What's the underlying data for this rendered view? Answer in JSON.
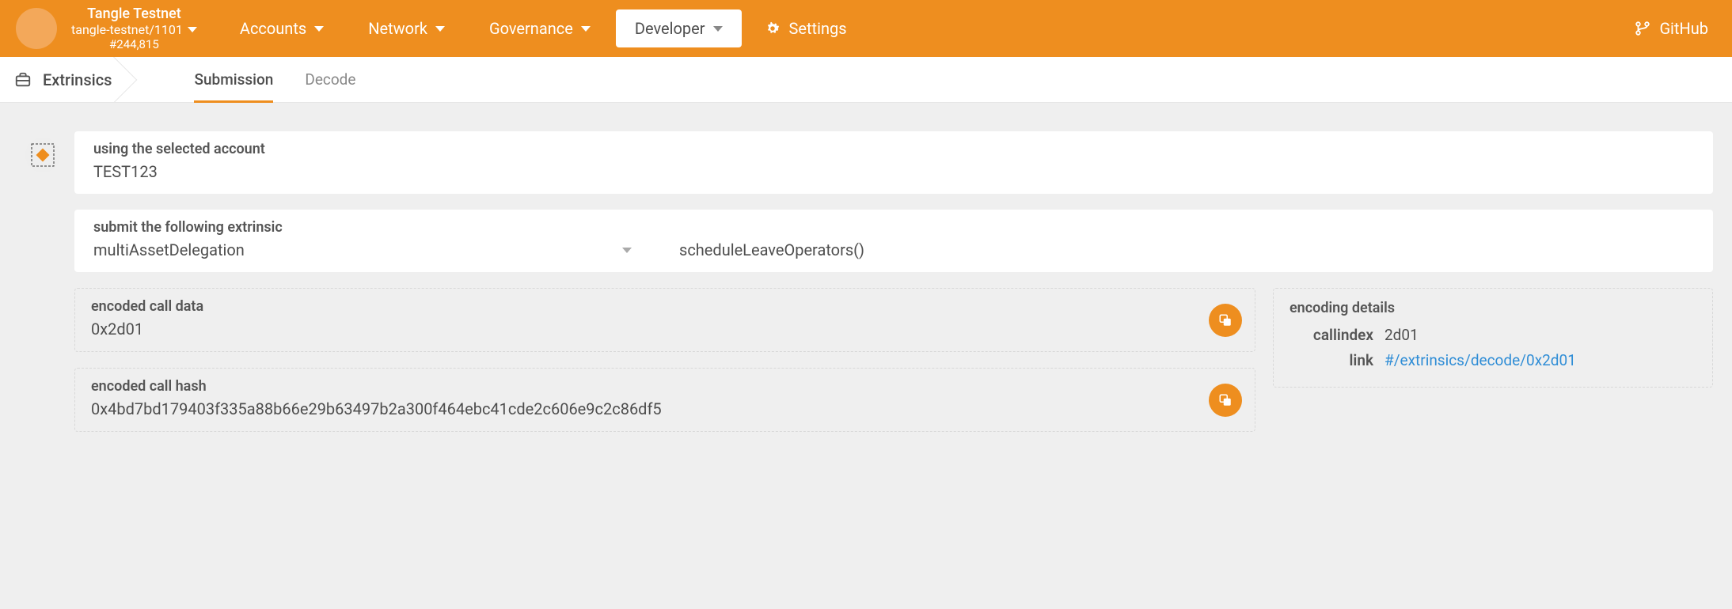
{
  "header": {
    "brand_name": "Tangle Testnet",
    "brand_sub": "tangle-testnet/1101",
    "block_number": "#244,815",
    "nav": {
      "accounts": "Accounts",
      "network": "Network",
      "governance": "Governance",
      "developer": "Developer",
      "settings": "Settings",
      "github": "GitHub"
    }
  },
  "breadcrumb": "Extrinsics",
  "tabs": {
    "submission": "Submission",
    "decode": "Decode"
  },
  "account": {
    "label": "using the selected account",
    "value": "TEST123"
  },
  "extrinsic": {
    "label": "submit the following extrinsic",
    "pallet": "multiAssetDelegation",
    "method": "scheduleLeaveOperators()"
  },
  "encoded_call_data": {
    "label": "encoded call data",
    "value": "0x2d01"
  },
  "encoded_call_hash": {
    "label": "encoded call hash",
    "value": "0x4bd7bd179403f335a88b66e29b63497b2a300f464ebc41cde2c606e9c2c86df5"
  },
  "encoding_details": {
    "label": "encoding details",
    "callindex_label": "callindex",
    "callindex_value": "2d01",
    "link_label": "link",
    "link_value": "#/extrinsics/decode/0x2d01"
  }
}
